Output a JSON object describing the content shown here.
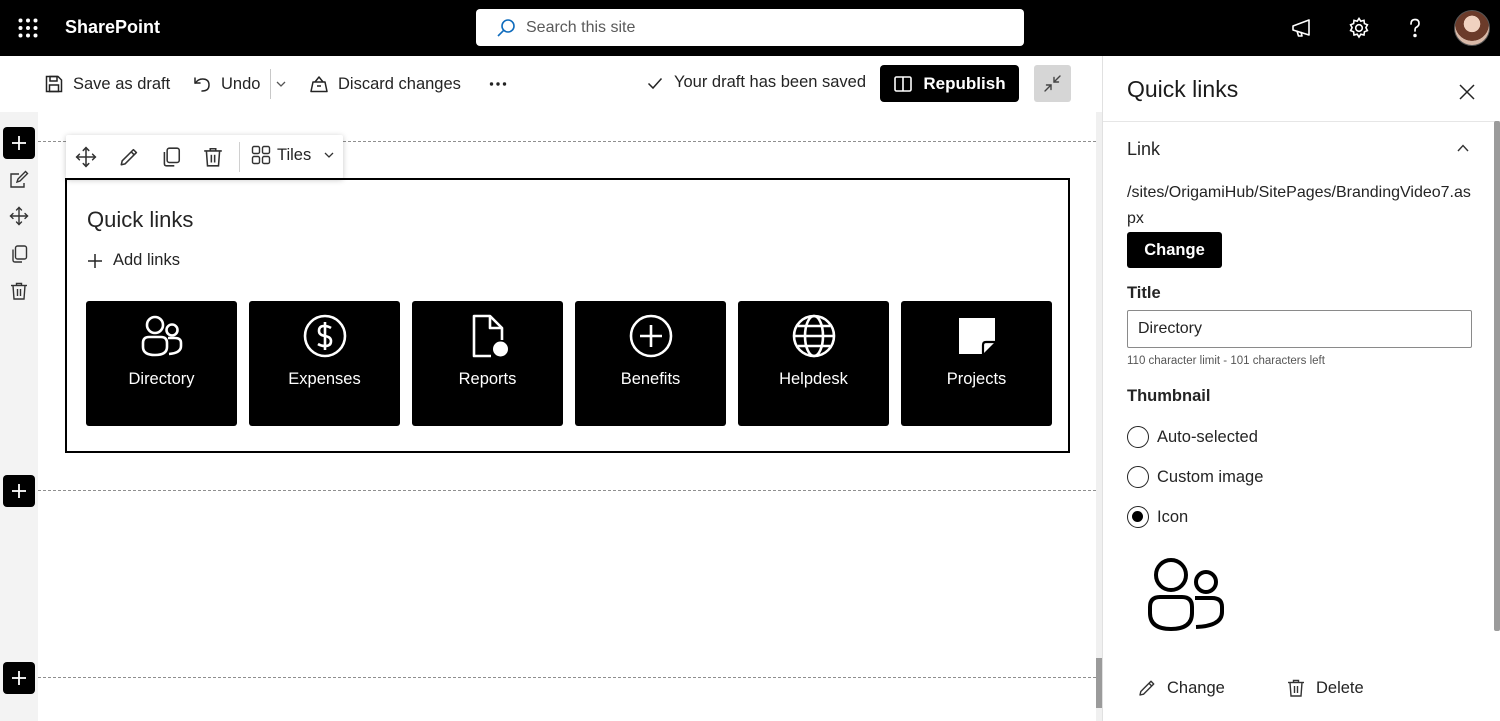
{
  "suite": {
    "app_name": "SharePoint",
    "search_placeholder": "Search this site"
  },
  "commands": {
    "save_draft": "Save as draft",
    "undo": "Undo",
    "discard": "Discard changes",
    "status": "Your draft has been saved",
    "republish": "Republish"
  },
  "toolbar": {
    "layout_label": "Tiles"
  },
  "webpart": {
    "title": "Quick links",
    "add_links": "Add links",
    "tiles": [
      {
        "label": "Directory",
        "icon": "people-icon"
      },
      {
        "label": "Expenses",
        "icon": "dollar-circle-icon"
      },
      {
        "label": "Reports",
        "icon": "document-icon"
      },
      {
        "label": "Benefits",
        "icon": "add-circle-icon"
      },
      {
        "label": "Helpdesk",
        "icon": "globe-icon"
      },
      {
        "label": "Projects",
        "icon": "sticky-note-icon"
      }
    ]
  },
  "pane": {
    "title": "Quick links",
    "section_link": "Link",
    "link_url": "/sites/OrigamiHub/SitePages/BrandingVideo7.aspx",
    "change_button": "Change",
    "title_label": "Title",
    "title_value": "Directory",
    "char_limit": "110 character limit - 101 characters left",
    "thumbnail_label": "Thumbnail",
    "thumbnail_options": [
      {
        "label": "Auto-selected",
        "selected": false
      },
      {
        "label": "Custom image",
        "selected": false
      },
      {
        "label": "Icon",
        "selected": true
      }
    ],
    "action_change": "Change",
    "action_delete": "Delete"
  },
  "colors": {
    "suite_bar": "#000000",
    "tile_background": "#000000",
    "primary_button": "#000000"
  }
}
